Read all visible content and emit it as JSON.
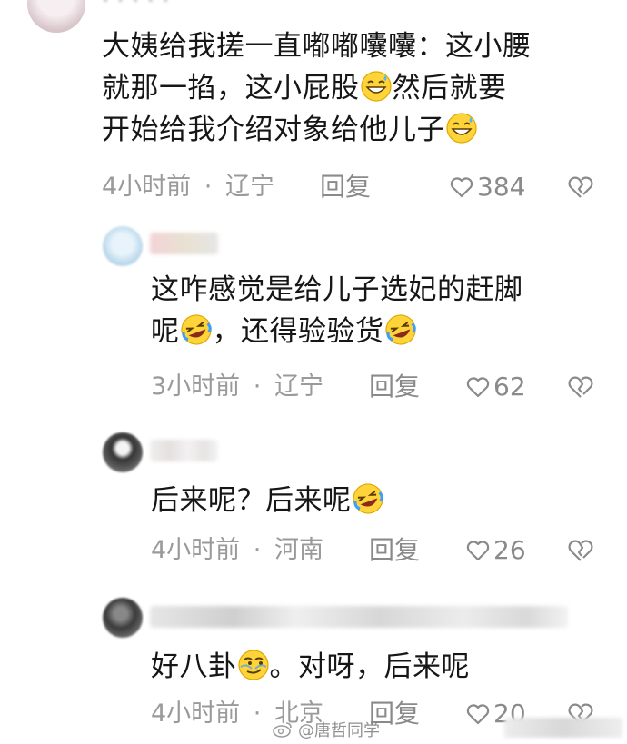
{
  "comments": [
    {
      "lines": [
        "大姨给我搓一直嘟嘟囔囔：这小腰",
        "就那一掐，这小屁股",
        "然后就要",
        "开始给我介绍对象给他儿子"
      ],
      "time": "4小时前",
      "location": "辽宁",
      "reply_label": "回复",
      "likes": "384",
      "sep": "·"
    },
    {
      "lines": [
        "这咋感觉是给儿子选妃的赶脚",
        "呢",
        "，还得验验货"
      ],
      "time": "3小时前",
      "location": "辽宁",
      "reply_label": "回复",
      "likes": "62",
      "sep": "·"
    },
    {
      "lines": [
        "后来呢？后来呢"
      ],
      "time": "4小时前",
      "location": "河南",
      "reply_label": "回复",
      "likes": "26",
      "sep": "·"
    },
    {
      "lines": [
        "好八卦",
        "。对呀，后来呢"
      ],
      "time": "4小时前",
      "location": "北京",
      "reply_label": "回复",
      "likes": "20",
      "sep": "·"
    }
  ],
  "watermark": {
    "text": "@唐哲同学",
    "icon": "weibo-icon"
  },
  "icons": {
    "like": "heart-outline-icon",
    "dislike": "broken-heart-icon",
    "emoji_sweat": "grin-sweat-emoji",
    "emoji_laugh": "rolling-laugh-emoji",
    "emoji_smirk": "smirk-emoji"
  },
  "colors": {
    "text": "#161616",
    "meta": "#9a9a9a",
    "background": "#ffffff"
  }
}
